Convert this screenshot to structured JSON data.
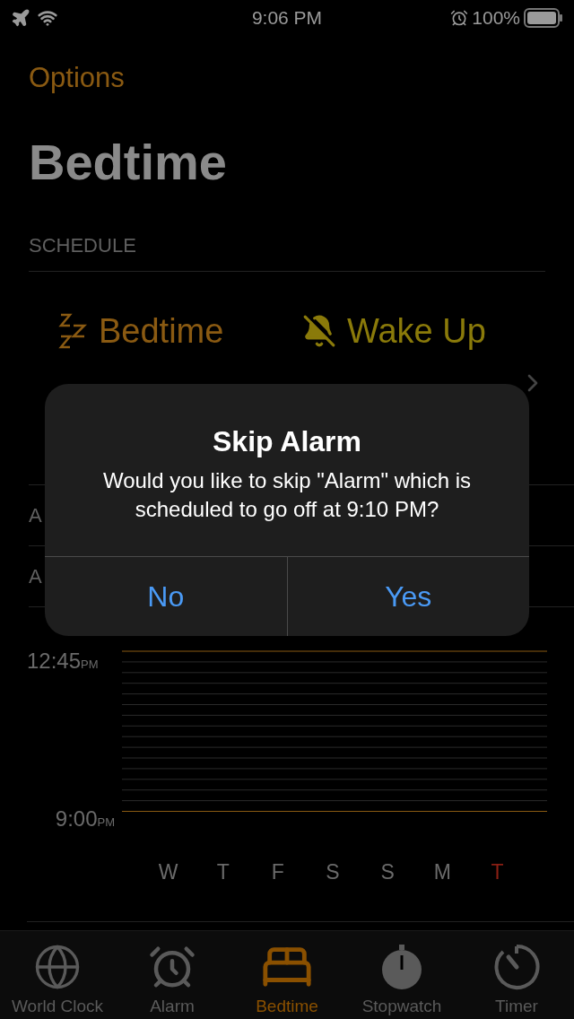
{
  "status_bar": {
    "time": "9:06 PM",
    "battery": "100%"
  },
  "nav": {
    "back": "Options",
    "title": "Bedtime"
  },
  "schedule": {
    "header": "SCHEDULE",
    "items": [
      {
        "kind": "bedtime",
        "label": "Bedtime"
      },
      {
        "kind": "wakeup",
        "label": "Wake Up"
      }
    ]
  },
  "rows": [
    "A",
    "A"
  ],
  "history": {
    "top_label": "12:45",
    "top_suffix": "PM",
    "bottom_label": "9:00",
    "bottom_suffix": "PM",
    "days": [
      {
        "label": "W",
        "today": false
      },
      {
        "label": "T",
        "today": false
      },
      {
        "label": "F",
        "today": false
      },
      {
        "label": "S",
        "today": false
      },
      {
        "label": "S",
        "today": false
      },
      {
        "label": "M",
        "today": false
      },
      {
        "label": "T",
        "today": true
      }
    ]
  },
  "alert": {
    "title": "Skip Alarm",
    "message": "Would you like to skip \"Alarm\" which is scheduled to go off at 9:10 PM?",
    "buttons": [
      "No",
      "Yes"
    ]
  },
  "tabs": [
    {
      "kind": "world",
      "label": "World Clock",
      "selected": false
    },
    {
      "kind": "alarm",
      "label": "Alarm",
      "selected": false
    },
    {
      "kind": "bedtime",
      "label": "Bedtime",
      "selected": true
    },
    {
      "kind": "stopwatch",
      "label": "Stopwatch",
      "selected": false
    },
    {
      "kind": "timer",
      "label": "Timer",
      "selected": false
    }
  ]
}
